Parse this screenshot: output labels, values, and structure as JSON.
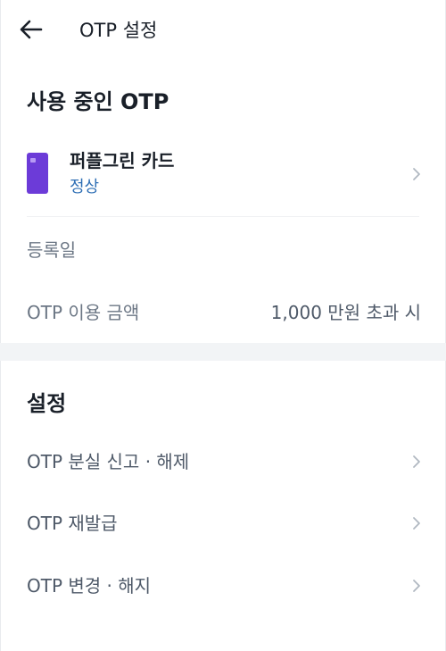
{
  "header": {
    "title": "OTP 설정"
  },
  "active_otp": {
    "section_title": "사용 중인 OTP",
    "card_name": "퍼플그린 카드",
    "card_status": "정상",
    "register_date_label": "등록일",
    "usage_amount_label": "OTP 이용 금액",
    "usage_amount_value": "1,000 만원 초과 시"
  },
  "settings": {
    "section_title": "설정",
    "items": [
      {
        "label": "OTP 분실 신고 · 해제"
      },
      {
        "label": "OTP 재발급"
      },
      {
        "label": "OTP 변경 · 해지"
      }
    ]
  },
  "icons": {
    "back": "arrow-left-icon",
    "chevron": "chevron-right-icon"
  },
  "colors": {
    "card": "#6c3bd8",
    "status": "#2f6fb5",
    "section_gap": "#f2f4f6"
  }
}
